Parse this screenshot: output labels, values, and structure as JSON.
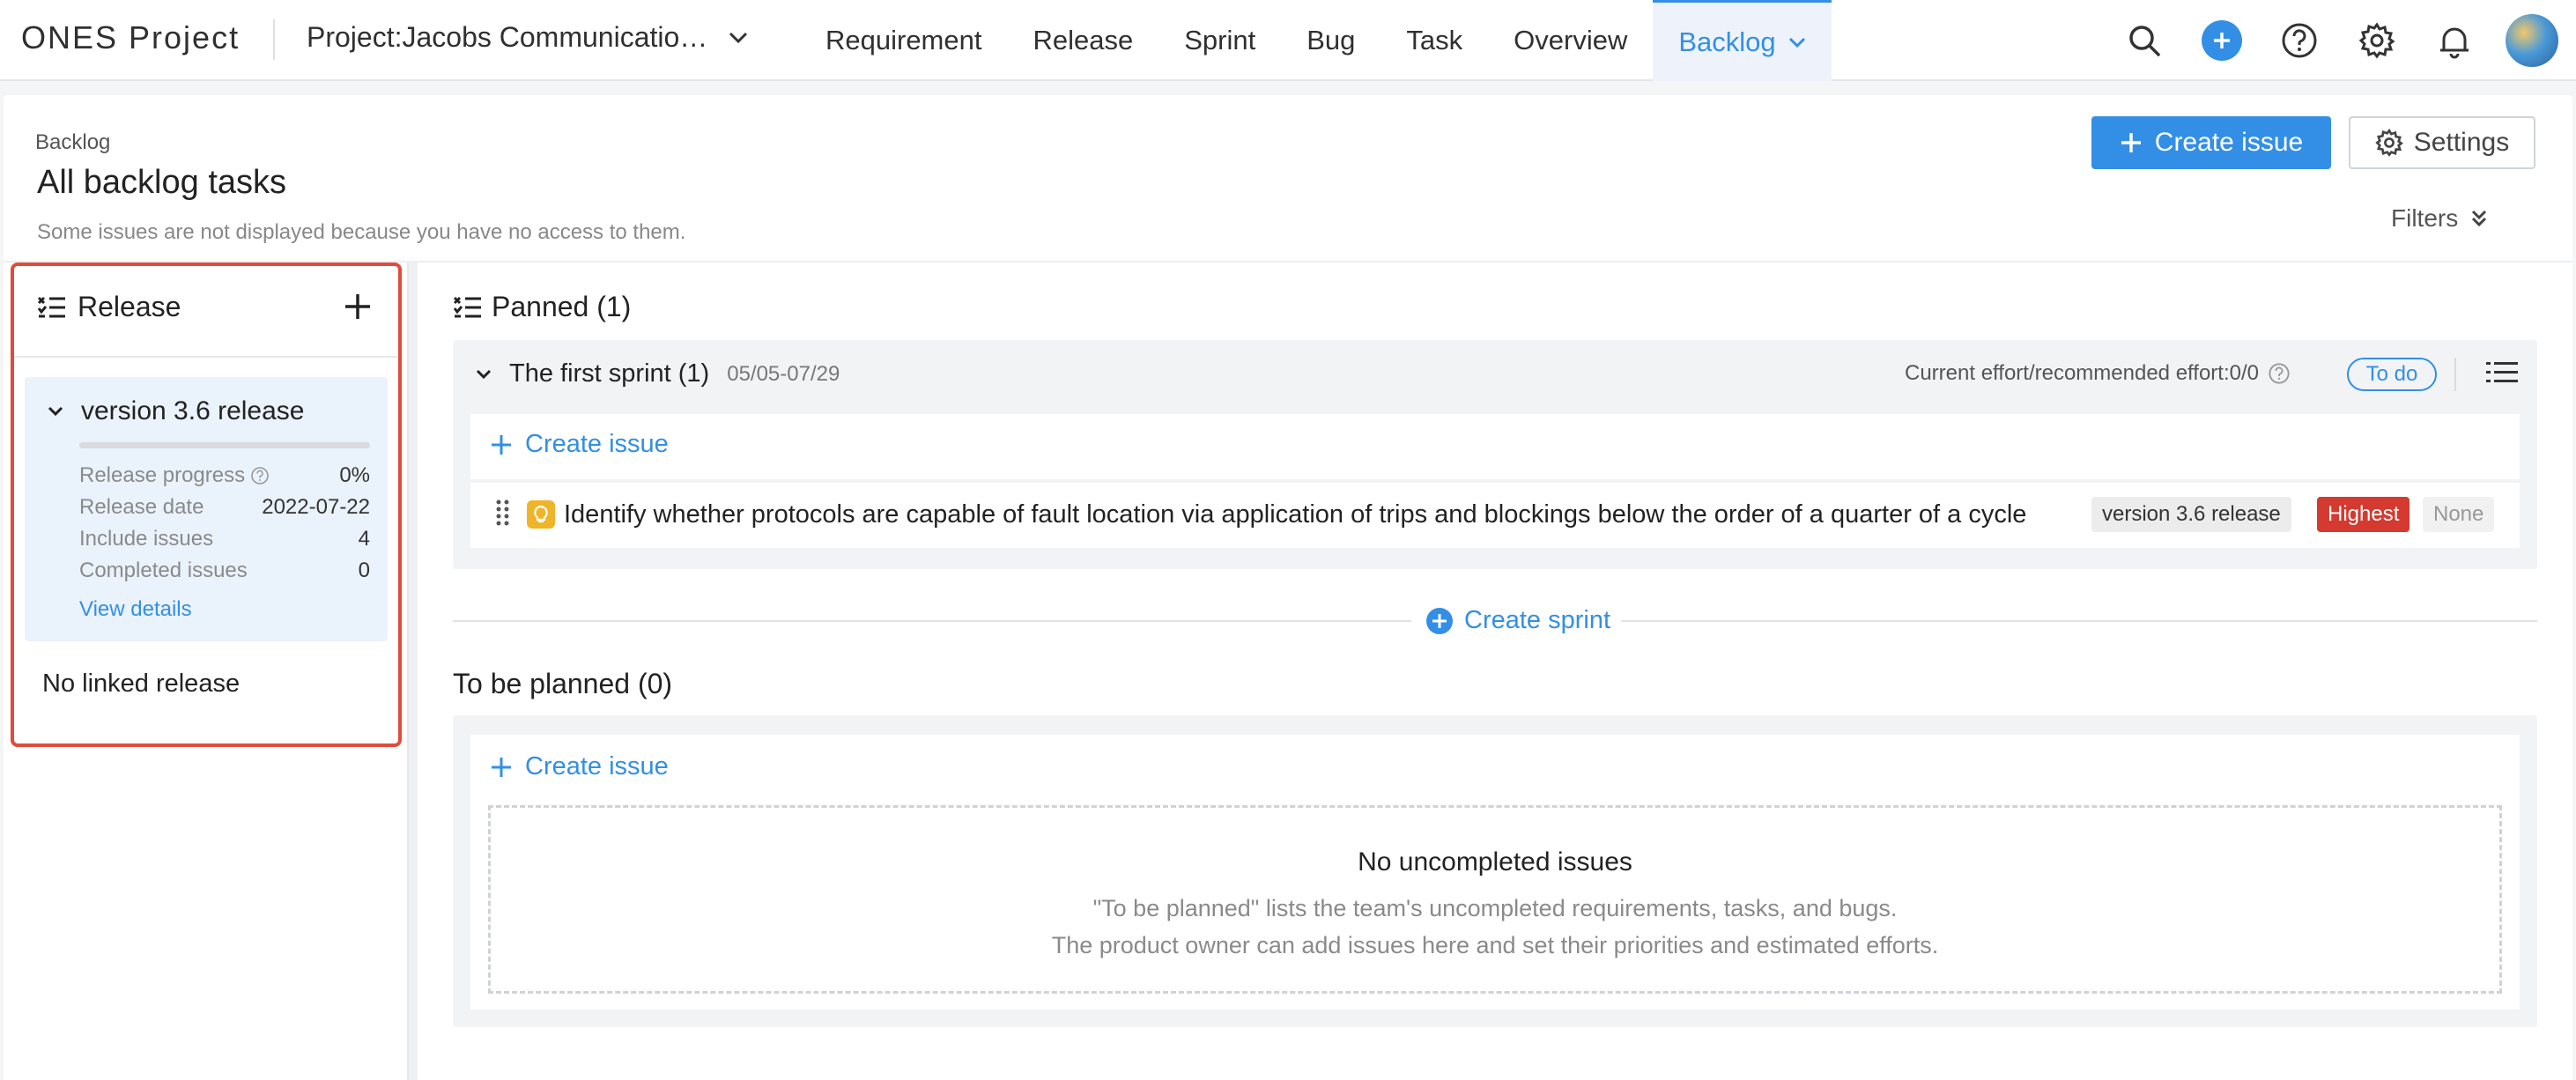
{
  "header": {
    "logo": "ONES Project",
    "project": "Project:Jacobs Communicatio…",
    "nav": [
      "Requirement",
      "Release",
      "Sprint",
      "Bug",
      "Task",
      "Overview"
    ],
    "active_nav": "Backlog",
    "icons": [
      "search-icon",
      "plus-circle-icon",
      "help-icon",
      "gear-icon",
      "bell-icon",
      "avatar"
    ]
  },
  "page": {
    "breadcrumb": "Backlog",
    "title": "All backlog tasks",
    "notice": "Some issues are not displayed because you have no access to them.",
    "create_issue": "Create issue",
    "settings": "Settings",
    "filters": "Filters"
  },
  "release_panel": {
    "title": "Release",
    "release": {
      "name": "version 3.6 release",
      "progress_fraction": 0,
      "rows": [
        {
          "key": "Release progress",
          "value": "0%"
        },
        {
          "key": "Release date",
          "value": "2022-07-22"
        },
        {
          "key": "Include issues",
          "value": "4"
        },
        {
          "key": "Completed issues",
          "value": "0"
        }
      ],
      "view_details": "View details"
    },
    "no_linked": "No linked release"
  },
  "planned": {
    "title": "Panned (1)",
    "sprint": {
      "name": "The first sprint (1)",
      "dates": "05/05-07/29",
      "effort": "Current effort/recommended effort:0/0",
      "status": "To do",
      "create_issue": "Create issue",
      "issue": {
        "title": "Identify whether protocols are capable of fault location via application of trips and blockings below the order of a quarter of a cycle",
        "release": "version 3.6 release",
        "priority": "Highest",
        "assignee": "None"
      }
    },
    "create_sprint": "Create sprint"
  },
  "to_be_planned": {
    "title": "To be planned (0)",
    "create_issue": "Create issue",
    "empty_title": "No uncompleted issues",
    "empty_line1": "\"To be planned\" lists the team's uncompleted requirements, tasks, and bugs.",
    "empty_line2": "The product owner can add issues here and set their priorities and estimated efforts."
  },
  "colors": {
    "accent": "#338fe5",
    "highlight_border": "#e04b3c",
    "priority_highest": "#d43a2f"
  }
}
